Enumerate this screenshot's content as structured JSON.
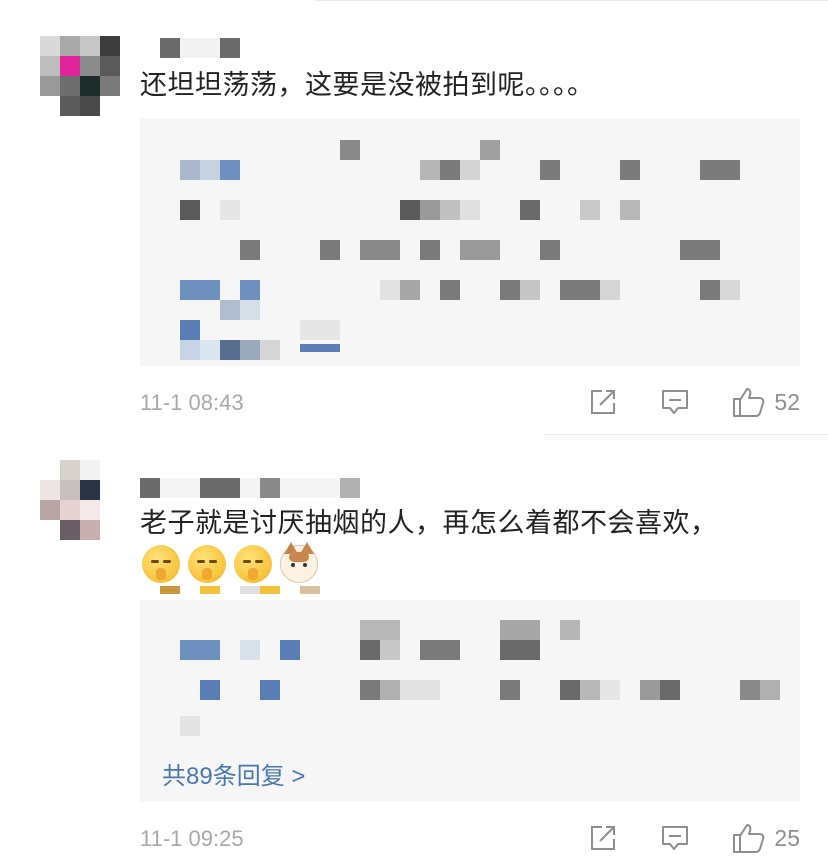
{
  "comments": [
    {
      "text": "还坦坦荡荡，这要是没被拍到呢。。。。",
      "timestamp": "11-1 08:43",
      "likes": "52",
      "icons": {
        "share": "share-icon",
        "comment": "comment-icon",
        "like": "thumbs-up-icon"
      }
    },
    {
      "text": "老子就是讨厌抽烟的人，再怎么着都不会喜欢，",
      "emojis": [
        "shush-face-emoji",
        "shush-face-emoji",
        "shush-face-emoji",
        "cat-face-emoji"
      ],
      "more_replies": "共89条回复 >",
      "timestamp": "11-1 09:25",
      "likes": "25",
      "icons": {
        "share": "share-icon",
        "comment": "comment-icon",
        "like": "thumbs-up-icon"
      }
    }
  ],
  "colors": {
    "link": "#4a78b5",
    "meta": "#a8a8a8",
    "reply_bg": "#f6f6f6"
  }
}
